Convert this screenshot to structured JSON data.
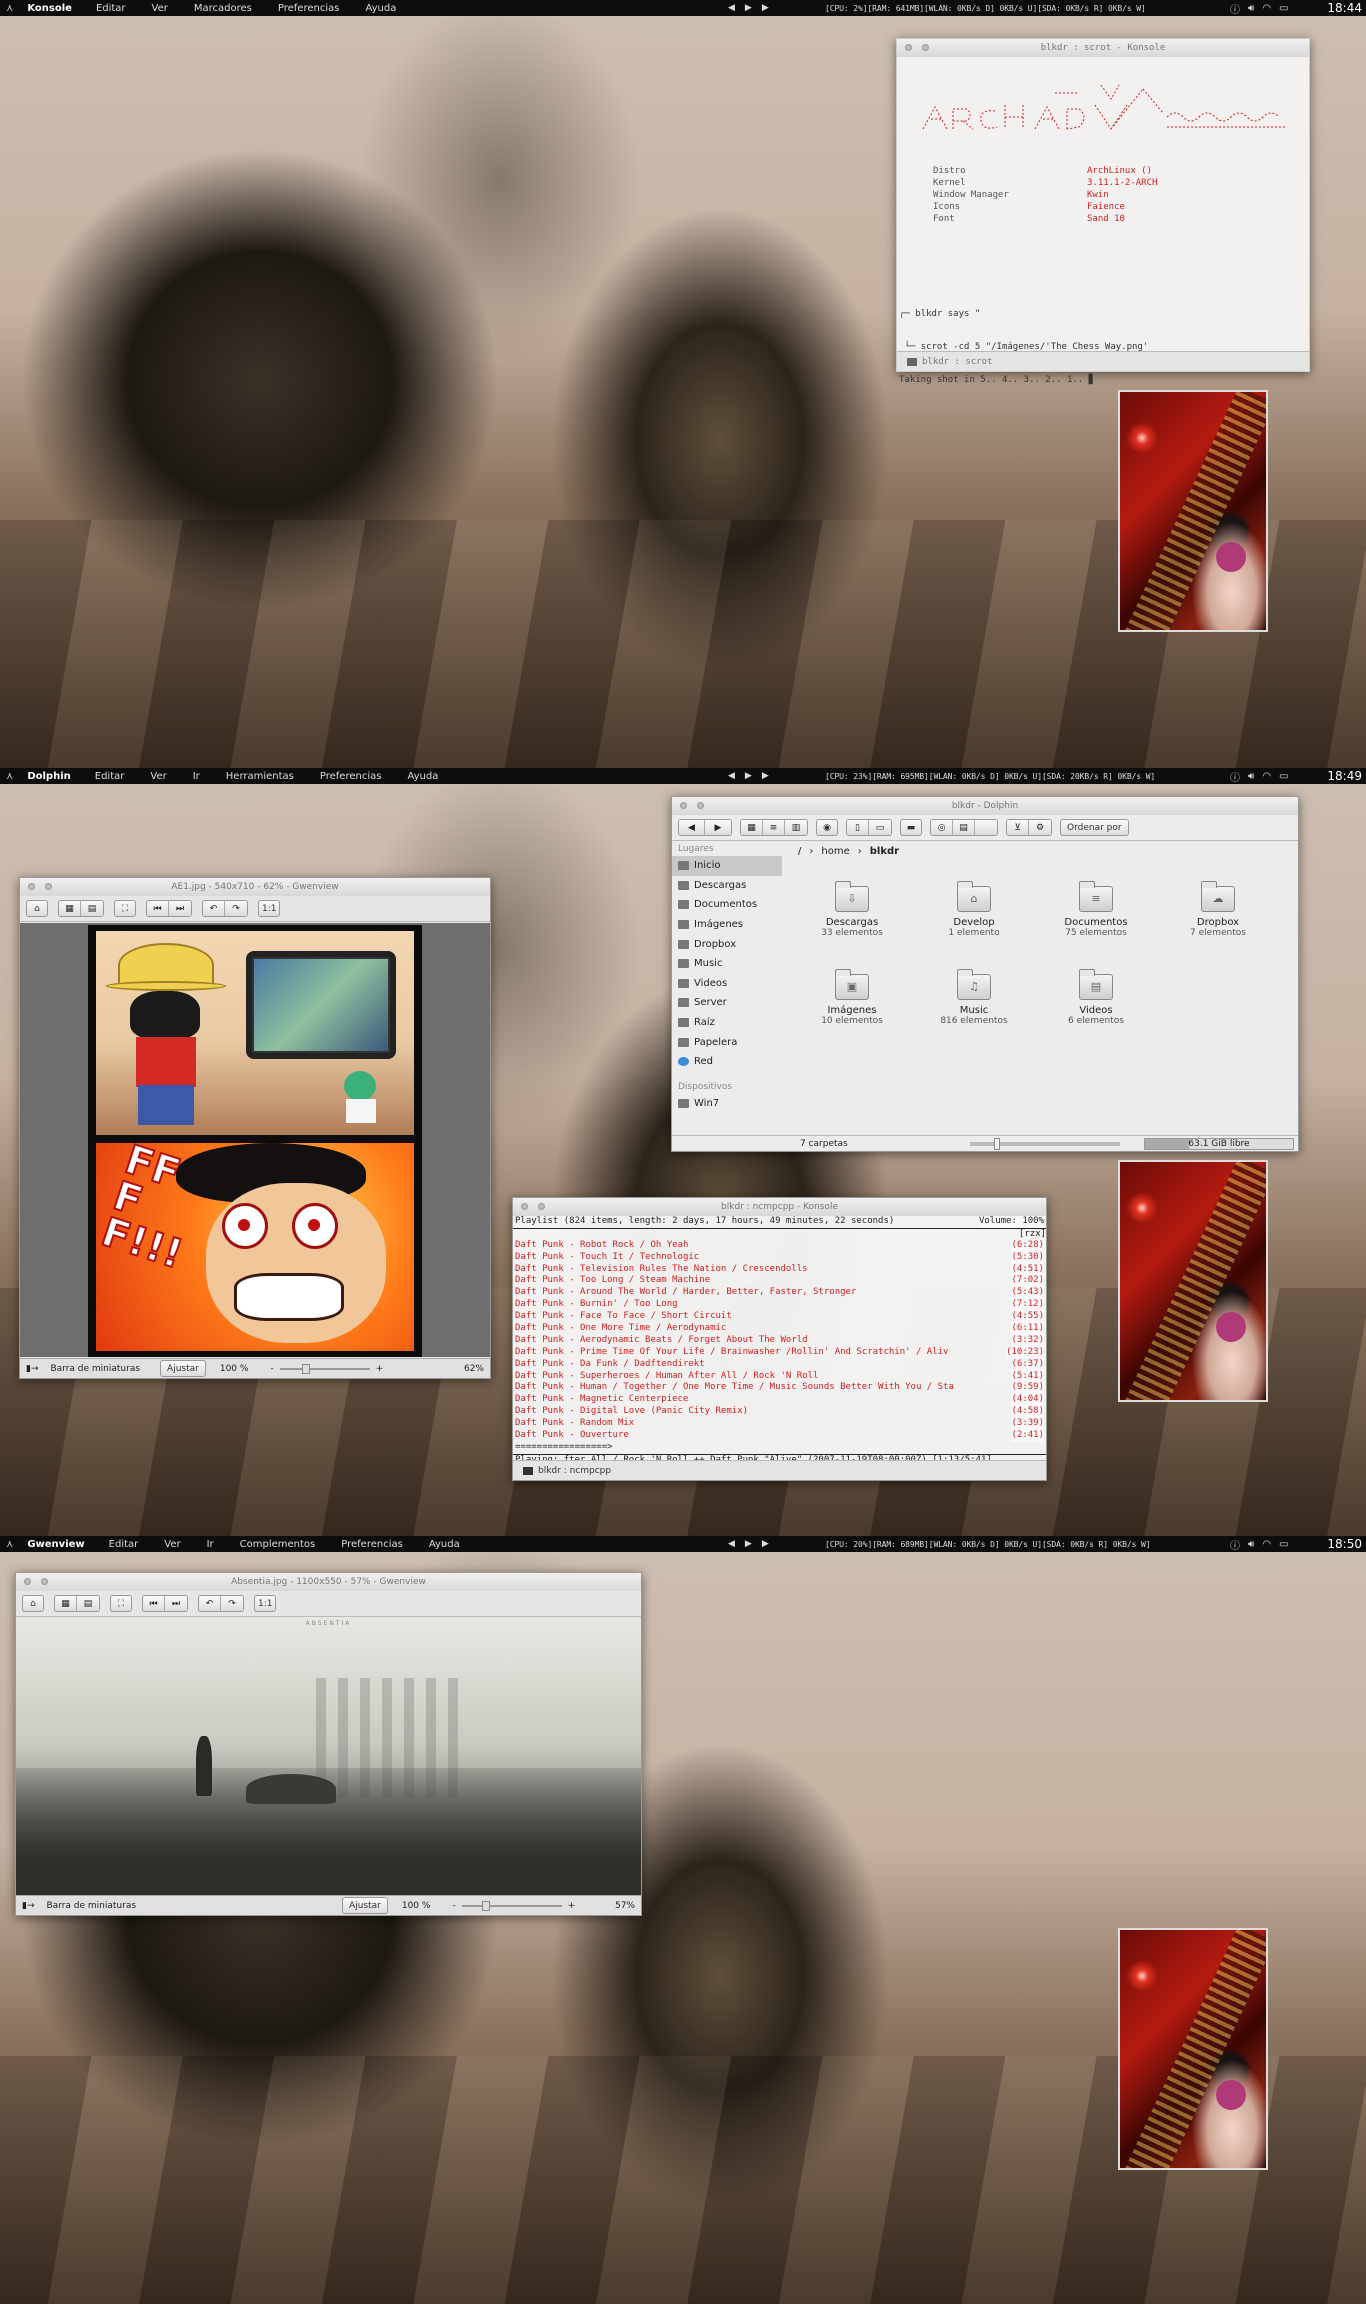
{
  "shot1": {
    "panel": {
      "launcher": "⋏",
      "app": "Konsole",
      "menus": [
        "Editar",
        "Ver",
        "Marcadores",
        "Preferencias",
        "Ayuda"
      ],
      "stats": "[CPU: 2%][RAM: 641MB][WLAN: 0KB/s D] 0KB/s U][SDA: 0KB/s R] 0KB/s W]",
      "clock": "18:44"
    },
    "terminal": {
      "title": "blkdr : scrot - Konsole",
      "info_keys": [
        "Distro",
        "Kernel",
        "Window Manager",
        "Icons",
        "Font"
      ],
      "info_vals": [
        "ArchLinux  ()",
        "3.11.1-2-ARCH",
        "Kwin",
        "Faience",
        "Sand 10"
      ],
      "prompt1": "┌─ blkdr says \"",
      "prompt2": " └─ scrot -cd 5 \"/Imágenes/'The Chess Way.png'",
      "prompt3": "Taking shot in 5.. 4.. 3.. 2.. 1.. ▊",
      "tab": "blkdr : scrot"
    }
  },
  "shot2": {
    "panel": {
      "launcher": "⋏",
      "app": "Dolphin",
      "menus": [
        "Editar",
        "Ver",
        "Ir",
        "Herramientas",
        "Preferencias",
        "Ayuda"
      ],
      "stats": "[CPU: 23%][RAM: 695MB][WLAN: 0KB/s D] 0KB/s U][SDA: 20KB/s R] 0KB/s W]",
      "clock": "18:49"
    },
    "gwen": {
      "title": "AE1.jpg - 540x710 - 62% - Gwenview",
      "toolbar": [
        "⌂",
        "▦",
        "▤",
        "⛶",
        "⏮",
        "⏭",
        "↶",
        "↷",
        "1:1"
      ],
      "thumb_bar": "Barra de miniaturas",
      "fit": "Ajustar",
      "zoom100": "100 %",
      "minus": "-",
      "plus": "+",
      "zoom": "62%",
      "manga_text": "FFFF!!!"
    },
    "dolphin": {
      "title": "blkdr - Dolphin",
      "sort": "Ordenar por",
      "places_header": "Lugares",
      "places": [
        "Inicio",
        "Descargas",
        "Documentos",
        "Imágenes",
        "Dropbox",
        "Music",
        "Videos",
        "Server",
        "Raíz",
        "Papelera",
        "Red"
      ],
      "devices_header": "Dispositivos",
      "devices": [
        "Win7"
      ],
      "crumbs": [
        "/",
        "home",
        "blkdr"
      ],
      "folders": [
        {
          "name": "Descargas",
          "count": "33 elementos",
          "glyph": "⇩"
        },
        {
          "name": "Develop",
          "count": "1 elemento",
          "glyph": "⌂"
        },
        {
          "name": "Documentos",
          "count": "75 elementos",
          "glyph": "≡"
        },
        {
          "name": "Dropbox",
          "count": "7 elementos",
          "glyph": "☁"
        },
        {
          "name": "Imágenes",
          "count": "10 elementos",
          "glyph": "▣"
        },
        {
          "name": "Music",
          "count": "816 elementos",
          "glyph": "♫"
        },
        {
          "name": "Videos",
          "count": "6 elementos",
          "glyph": "▤"
        }
      ],
      "status_left": "7 carpetas",
      "status_right": "63.1 GiB libre"
    },
    "ncmpcpp": {
      "title": "blkdr : ncmpcpp - Konsole",
      "header": "Playlist (824 items, length: 2 days, 17 hours, 49 minutes, 22 seconds)",
      "volume": "Volume: 100%",
      "flags": "[rzx]",
      "tracks": [
        {
          "t": "Daft Punk - Robot Rock / Oh Yeah",
          "d": "(6:28)"
        },
        {
          "t": "Daft Punk - Touch It / Technologic",
          "d": "(5:30)"
        },
        {
          "t": "Daft Punk - Television Rules The Nation / Crescendolls",
          "d": "(4:51)"
        },
        {
          "t": "Daft Punk - Too Long / Steam Machine",
          "d": "(7:02)"
        },
        {
          "t": "Daft Punk - Around The World / Harder, Better, Faster, Stronger",
          "d": "(5:43)"
        },
        {
          "t": "Daft Punk - Burnin' / Too Long",
          "d": "(7:12)"
        },
        {
          "t": "Daft Punk - Face To Face / Short Circuit",
          "d": "(4:55)"
        },
        {
          "t": "Daft Punk - One More Time / Aerodynamic",
          "d": "(6:11)"
        },
        {
          "t": "Daft Punk - Aerodynamic Beats / Forget About The World",
          "d": "(3:32)"
        },
        {
          "t": "Daft Punk - Prime Time Of Your Life / Brainwasher /Rollin' And Scratchin' / Aliv",
          "d": "(10:23)"
        },
        {
          "t": "Daft Punk - Da Funk / Dadftendirekt",
          "d": "(6:37)"
        },
        {
          "t": "Daft Punk - Superheroes / Human After All / Rock 'N Roll",
          "d": "(5:41)"
        },
        {
          "t": "Daft Punk - Human / Together / One More Time / Music Sounds Better With You / Sta",
          "d": "(9:59)"
        },
        {
          "t": "Daft Punk - Magnetic Centerpiece",
          "d": "(4:04)"
        },
        {
          "t": "Daft Punk - Digital Love (Panic City Remix)",
          "d": "(4:58)"
        },
        {
          "t": "Daft Punk - Random Mix",
          "d": "(3:39)"
        },
        {
          "t": "Daft Punk - Ouverture",
          "d": "(2:41)"
        }
      ],
      "progress": "=================>",
      "playing": "Playing: fter All / Rock 'N Roll ++ Daft Punk \"Alive\" (2007-11-19T08:00:00Z) [1:13/5:41]",
      "tab": "blkdr : ncmpcpp"
    }
  },
  "shot3": {
    "panel": {
      "launcher": "⋏",
      "app": "Gwenview",
      "menus": [
        "Editar",
        "Ver",
        "Ir",
        "Complementos",
        "Preferencias",
        "Ayuda"
      ],
      "stats": "[CPU: 20%][RAM: 689MB][WLAN: 0KB/s D] 0KB/s U][SDA: 0KB/s R] 0KB/s W]",
      "clock": "18:50"
    },
    "gwen": {
      "title": "Absentia.jpg - 1100x550 - 57% - Gwenview",
      "toolbar": [
        "⌂",
        "▦",
        "▤",
        "⛶",
        "⏮",
        "⏭",
        "↶",
        "↷",
        "1:1"
      ],
      "thumb_bar": "Barra de miniaturas",
      "fit": "Ajustar",
      "zoom100": "100 %",
      "minus": "-",
      "plus": "+",
      "zoom": "57%",
      "caption": "ABSENTIA"
    }
  },
  "media_icons": [
    "◀",
    "▶",
    "▶"
  ],
  "tray_icons": [
    "info-icon",
    "volume-icon",
    "wifi-icon",
    "battery-icon"
  ]
}
